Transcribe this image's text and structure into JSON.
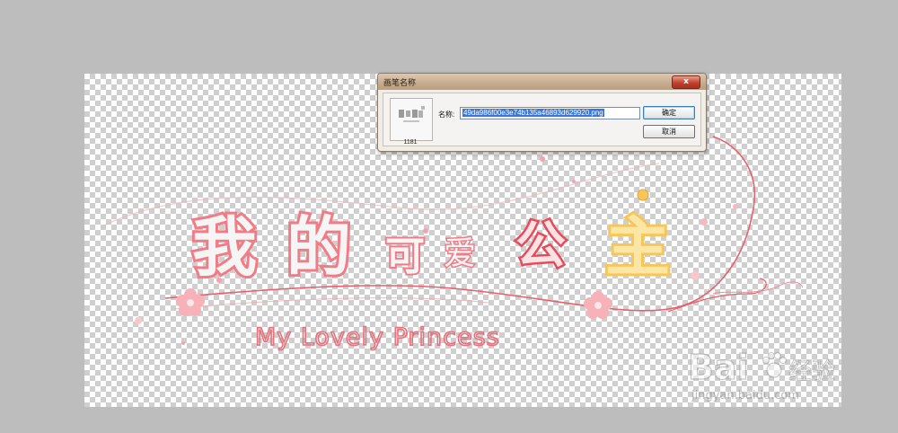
{
  "dialog": {
    "title": "画笔名称",
    "close_symbol": "x",
    "thumbnail_count": "1181",
    "name_label": "名称:",
    "name_value": "49da986f00e3e74b135a46893d629920.png",
    "ok_label": "确定",
    "cancel_label": "取消"
  },
  "artwork": {
    "title_cn": "我的可爱公主",
    "subtitle_en": "My Lovely Princess"
  },
  "watermark": {
    "brand": "Bai",
    "brand_suffix": "经验",
    "url": "jingyan.baidu.com"
  },
  "colors": {
    "title_pink": "#f27b86",
    "title_red": "#e84a5a",
    "title_yellow": "#f6c65a",
    "subtitle_pink": "#e8717c",
    "workspace_bg": "#bdbdbd"
  }
}
